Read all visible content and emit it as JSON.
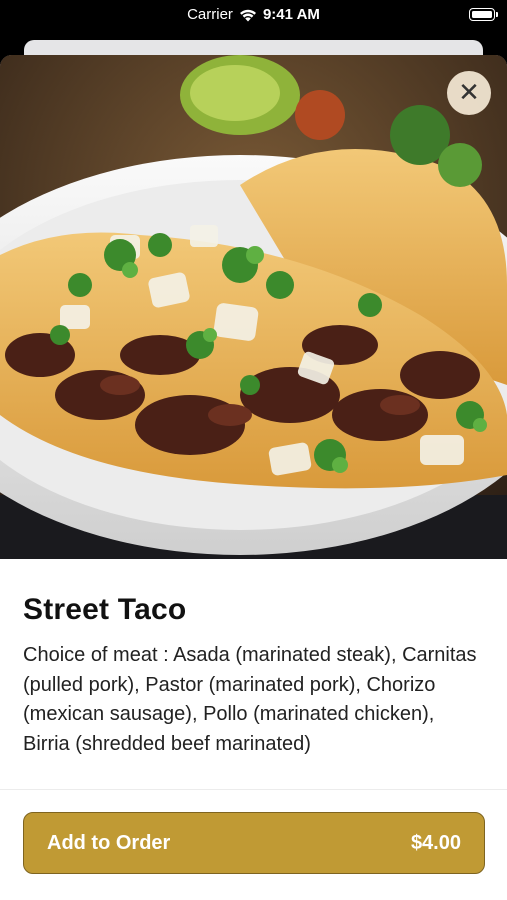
{
  "status_bar": {
    "carrier": "Carrier",
    "time": "9:41 AM"
  },
  "hero": {
    "image_icon": "street-taco-photo"
  },
  "close_icon_glyph": "✕",
  "item": {
    "title": "Street Taco",
    "description": "Choice of meat : Asada (marinated steak), Carnitas (pulled pork), Pastor (marinated pork), Chorizo (mexican sausage), Pollo (marinated chicken), Birria (shredded beef marinated)"
  },
  "footer": {
    "button_label": "Add to Order",
    "price": "$4.00"
  },
  "colors": {
    "accent": "#c09a34",
    "accent_border": "#7e6420"
  }
}
